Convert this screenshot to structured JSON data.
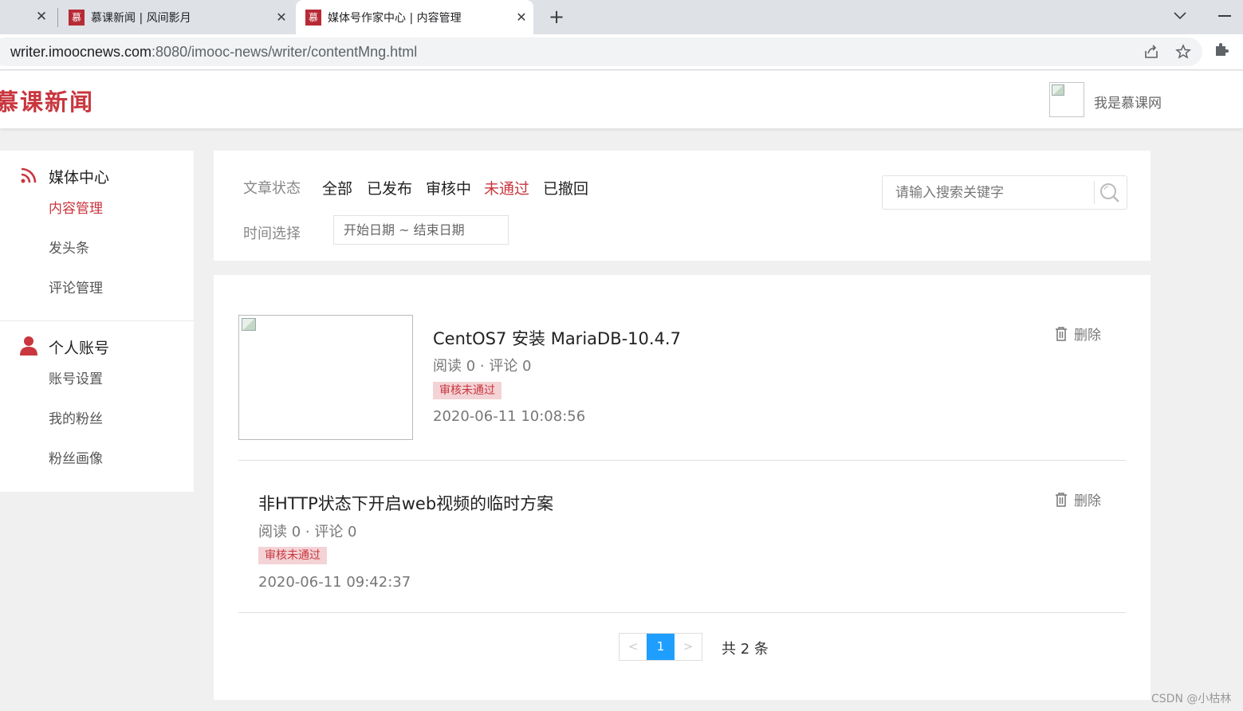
{
  "browser": {
    "tabs": [
      {
        "title": "慕课新闻 | 风间影月",
        "favicon": "慕"
      },
      {
        "title": "媒体号作家中心 | 内容管理",
        "favicon": "慕"
      }
    ],
    "url_host": "writer.imoocnews.com",
    "url_rest": ":8080/imooc-news/writer/contentMng.html",
    "icons": [
      "close-icon",
      "plus-icon",
      "chevron-down-icon",
      "minimize-icon",
      "share-icon",
      "star-icon",
      "puzzle-icon"
    ]
  },
  "header": {
    "logo_text": "慕课新闻",
    "username": "我是慕课网"
  },
  "sidebar": {
    "sections": [
      {
        "title": "媒体中心",
        "icon": "rss-icon",
        "items": [
          {
            "label": "内容管理",
            "active": true
          },
          {
            "label": "发头条",
            "active": false
          },
          {
            "label": "评论管理",
            "active": false
          }
        ]
      },
      {
        "title": "个人账号",
        "icon": "user-icon",
        "items": [
          {
            "label": "账号设置",
            "active": false
          },
          {
            "label": "我的粉丝",
            "active": false
          },
          {
            "label": "粉丝画像",
            "active": false
          }
        ]
      }
    ]
  },
  "filters": {
    "status_label": "文章状态",
    "statuses": [
      {
        "label": "全部",
        "active": false
      },
      {
        "label": "已发布",
        "active": false
      },
      {
        "label": "审核中",
        "active": false
      },
      {
        "label": "未通过",
        "active": true
      },
      {
        "label": "已撤回",
        "active": false
      }
    ],
    "time_label": "时间选择",
    "date_range": "开始日期 ~ 结束日期",
    "search_placeholder": "请输入搜索关键字"
  },
  "articles": [
    {
      "title": "CentOS7 安装 MariaDB-10.4.7",
      "meta": "阅读 0 · 评论 0",
      "badge": "审核未通过",
      "date": "2020-06-11 10:08:56",
      "has_cover": true,
      "delete_label": "删除"
    },
    {
      "title": "非HTTP状态下开启web视频的临时方案",
      "meta": "阅读 0 · 评论 0",
      "badge": "审核未通过",
      "date": "2020-06-11 09:42:37",
      "has_cover": false,
      "delete_label": "删除"
    }
  ],
  "pagination": {
    "prev": "<",
    "current": "1",
    "next": ">",
    "total_text": "共 2 条"
  },
  "colors": {
    "brand": "#c9363e",
    "pager_active": "#1e9fff",
    "badge_bg": "#f3d3d5"
  },
  "watermark": "CSDN @小枯林"
}
